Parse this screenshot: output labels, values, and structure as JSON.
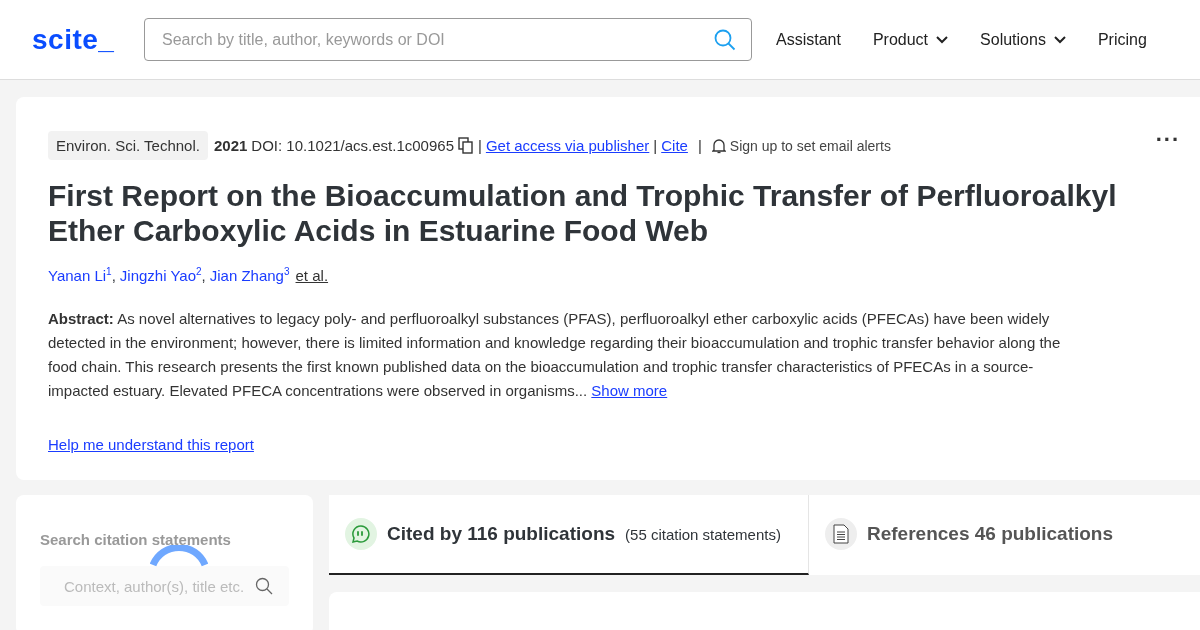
{
  "header": {
    "logo": "scite_",
    "search": {
      "placeholder": "Search by title, author, keywords or DOI"
    },
    "nav": [
      {
        "label": "Assistant",
        "dropdown": false
      },
      {
        "label": "Product",
        "dropdown": true
      },
      {
        "label": "Solutions",
        "dropdown": true
      },
      {
        "label": "Pricing",
        "dropdown": false
      }
    ]
  },
  "article": {
    "journal": "Environ. Sci. Technol.",
    "year": "2021",
    "doi": "DOI: 10.1021/acs.est.1c00965",
    "separator": "|",
    "links": [
      {
        "label": "Get access via publisher"
      },
      {
        "label": "Cite"
      }
    ],
    "alert": "Sign up to set email alerts",
    "more": "...",
    "title": "First Report on the Bioaccumulation and Trophic Transfer of Perfluoroalkyl Ether Carboxylic Acids in Estuarine Food Web",
    "authors": [
      {
        "name": "Yanan Li",
        "index": "1",
        "separator": ","
      },
      {
        "name": "Jingzhi Yao",
        "index": "2",
        "separator": ","
      },
      {
        "name": "Jian Zhang",
        "index": "3"
      }
    ],
    "et_al": "et al.",
    "abstract": "**Abstract:** As novel alternatives to legacy poly- and perfluoroalkyl substances (PFAS), perfluoroalkyl ether carboxylic acids (PFECAs) have been widely detected in the environment; however, there is limited information and knowledge regarding their bioaccumulation and trophic transfer behavior along the food chain. This research presents the first known published data on the bioaccumulation and trophic transfer characteristics of PFECAs in a source-impacted estuary. Elevated PFECA concentrations were observed in organisms...",
    "show_more": "Show more",
    "help": "Help me understand this report"
  },
  "citation_search": {
    "heading": "Search citation statements",
    "placeholder": "Context, author(s), title etc."
  },
  "tabs": [
    {
      "kind": "cited",
      "label": "Cited by 116 publications",
      "note": "(55 citation statements)",
      "selected": true
    },
    {
      "kind": "references",
      "label": "References 46 publications",
      "selected": false
    }
  ]
}
